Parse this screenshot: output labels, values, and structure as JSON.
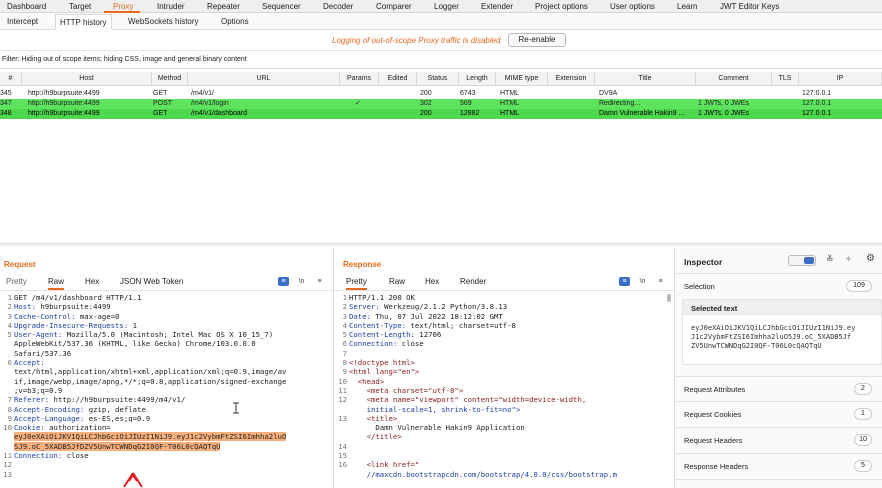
{
  "top_tabs": [
    "Dashboard",
    "Target",
    "Proxy",
    "Intruder",
    "Repeater",
    "Sequencer",
    "Decoder",
    "Comparer",
    "Logger",
    "Extender",
    "Project options",
    "User options",
    "Learn",
    "JWT Editor Keys"
  ],
  "sub_tabs": [
    "Intercept",
    "HTTP history",
    "WebSockets history",
    "Options"
  ],
  "log_message": "Logging of out-of-scope Proxy traffic is disabled",
  "reenable_label": "Re-enable",
  "filter_text": "Filter: Hiding out of scope items;  hiding CSS, image and general binary content",
  "table": {
    "columns": [
      "#",
      "Host",
      "Method",
      "URL",
      "Params",
      "Edited",
      "Status",
      "Length",
      "MIME type",
      "Extension",
      "Title",
      "Comment",
      "TLS",
      "IP"
    ],
    "rows": [
      {
        "num": "345",
        "host": "http://h9burpsuite:4499",
        "method": "GET",
        "url": "/m4/v1/",
        "params": "",
        "edited": "",
        "status": "200",
        "length": "6743",
        "mime": "HTML",
        "ext": "",
        "title": "DV9A",
        "comment": "",
        "tls": "",
        "ip": "127.0.0.1"
      },
      {
        "num": "347",
        "host": "http://h9burpsuite:4499",
        "method": "POST",
        "url": "/m4/v1/login",
        "params": "✓",
        "edited": "",
        "status": "302",
        "length": "569",
        "mime": "HTML",
        "ext": "",
        "title": "Redirecting...",
        "comment": "1 JWTs, 0 JWEs",
        "tls": "",
        "ip": "127.0.0.1"
      },
      {
        "num": "348",
        "host": "http://h9burpsuite:4499",
        "method": "GET",
        "url": "/m4/v1/dashboard",
        "params": "",
        "edited": "",
        "status": "200",
        "length": "12882",
        "mime": "HTML",
        "ext": "",
        "title": "Damn Vulnerable Hakin9 ...",
        "comment": "1 JWTs, 0 JWEs",
        "tls": "",
        "ip": "127.0.0.1"
      }
    ]
  },
  "request": {
    "title": "Request",
    "tabs": [
      "Pretty",
      "Raw",
      "Hex",
      "JSON Web Token"
    ],
    "lines": [
      {
        "n": "1",
        "t": "GET /m4/v1/dashboard HTTP/1.1"
      },
      {
        "n": "2",
        "k": "Host:",
        "t": " h9burpsuite:4499"
      },
      {
        "n": "3",
        "k": "Cache-Control:",
        "t": " max-age=0"
      },
      {
        "n": "4",
        "k": "Upgrade-Insecure-Requests:",
        "t": " 1"
      },
      {
        "n": "5",
        "k": "User-Agent:",
        "t": " Mozilla/5.0 (Macintosh; Intel Mac OS X 10_15_7)"
      },
      {
        "n": "",
        "t": "AppleWebKit/537.36 (KHTML, like Gecko) Chrome/103.0.0.0"
      },
      {
        "n": "",
        "t": "Safari/537.36"
      },
      {
        "n": "6",
        "k": "Accept:",
        "t": ""
      },
      {
        "n": "",
        "t": "text/html,application/xhtml+xml,application/xml;q=0.9,image/av"
      },
      {
        "n": "",
        "t": "if,image/webp,image/apng,*/*;q=0.8,application/signed-exchange"
      },
      {
        "n": "",
        "t": ";v=b3;q=0.9"
      },
      {
        "n": "7",
        "k": "Referer:",
        "t": " http://h9burpsuite:4499/m4/v1/"
      },
      {
        "n": "8",
        "k": "Accept-Encoding:",
        "t": " gzip, deflate"
      },
      {
        "n": "9",
        "k": "Accept-Language:",
        "t": " es-ES,es;q=0.9"
      },
      {
        "n": "10",
        "k": "Cookie:",
        "t": " authorization="
      },
      {
        "n": "",
        "h": "eyJ0eXAiOiJKV1QiLCJhbGciOiJIUzI1NiJ9.eyJ1c2VybmFtZSI6Imhha2luO"
      },
      {
        "n": "",
        "h": "SJ9.oC_5XADB5JfDZV5UnwTCWNDqG2I0QF-T06L0cQAQTqU"
      },
      {
        "n": "11",
        "k": "Connection:",
        "t": " close"
      },
      {
        "n": "12",
        "t": ""
      },
      {
        "n": "13",
        "t": ""
      }
    ]
  },
  "response": {
    "title": "Response",
    "tabs": [
      "Pretty",
      "Raw",
      "Hex",
      "Render"
    ],
    "lines": [
      {
        "n": "1",
        "t": "HTTP/1.1 200 OK"
      },
      {
        "n": "2",
        "k": "Server:",
        "t": " Werkzeug/2.1.2 Python/3.8.13"
      },
      {
        "n": "3",
        "k": "Date:",
        "t": " Thu, 07 Jul 2022 18:12:02 GMT"
      },
      {
        "n": "4",
        "k": "Content-Type:",
        "t": " text/html; charset=utf-8"
      },
      {
        "n": "5",
        "k": "Content-Length:",
        "t": " 12706"
      },
      {
        "n": "6",
        "k": "Connection:",
        "t": " close"
      },
      {
        "n": "7",
        "t": ""
      },
      {
        "n": "8",
        "g": "<!doctype html>"
      },
      {
        "n": "9",
        "g": "<html lang=\"en\">"
      },
      {
        "n": "10",
        "g": "  <head>"
      },
      {
        "n": "11",
        "g": "    <meta charset=\"utf-8\">"
      },
      {
        "n": "12",
        "g": "    <meta name=\"viewport\" content=\"width=device-width,"
      },
      {
        "n": "",
        "g": "    initial-scale=1, shrink-to-fit=no\">"
      },
      {
        "n": "13",
        "g": "    <title>"
      },
      {
        "n": "",
        "t": "      Damn Vulnerable Hakin9 Application"
      },
      {
        "n": "",
        "g": "    </title>"
      },
      {
        "n": "14",
        "t": ""
      },
      {
        "n": "15",
        "t": ""
      },
      {
        "n": "16",
        "g": "    <link href=\""
      },
      {
        "n": "",
        "g": "    //maxcdn.bootstrapcdn.com/bootstrap/4.0.0/css/bootstrap.m"
      }
    ]
  },
  "inspector": {
    "title": "Inspector",
    "selection_label": "Selection",
    "selection_count": "109",
    "selected_text_label": "Selected text",
    "selected_text": [
      "eyJ0eXAiOiJKV1QiLCJhbGciOiJIUzI1NiJ9.ey",
      "J1c2VybmFtZSI6Imhha2luO5J9.oC_5XADB5Jf",
      "ZV5UnwTCWNDqG2I0QF-T06L0cQAQTqU"
    ],
    "rows": [
      {
        "label": "Request Attributes",
        "count": "2"
      },
      {
        "label": "Request Cookies",
        "count": "1"
      },
      {
        "label": "Request Headers",
        "count": "10"
      },
      {
        "label": "Response Headers",
        "count": "5"
      }
    ]
  },
  "colors": {
    "accent": "#e8691e",
    "row_highlight": "#4ed84e",
    "selection": "#f7b07d"
  }
}
